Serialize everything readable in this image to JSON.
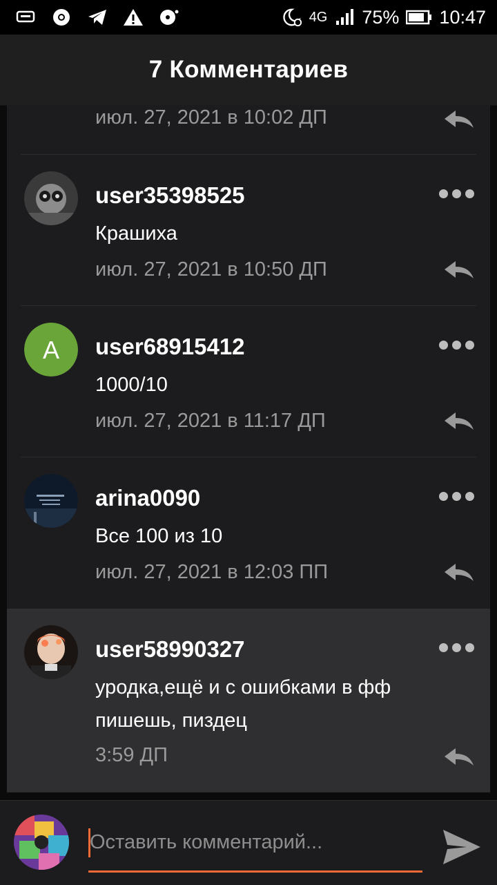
{
  "statusbar": {
    "network": "4G",
    "battery": "75%",
    "time": "10:47",
    "icons": [
      "chat-icon",
      "chrome-icon",
      "telegram-icon",
      "warning-icon",
      "cd-icon",
      "moon-alarm-icon",
      "signal-icon",
      "battery-icon"
    ]
  },
  "header": {
    "title": "7 Комментариев"
  },
  "partial": {
    "date": "июл. 27, 2021 в 10:02 ДП"
  },
  "comments": [
    {
      "username": "user35398525",
      "text": "Крашиха",
      "date": "июл. 27, 2021 в 10:50 ДП",
      "avatar": "photo"
    },
    {
      "username": "user68915412",
      "text": "1000/10",
      "date": "июл. 27, 2021 в 11:17 ДП",
      "avatar_letter": "A",
      "avatar_color": "#6aa53a"
    },
    {
      "username": "arina0090",
      "text": "Все 100 из 10",
      "date": "июл. 27, 2021 в 12:03 ПП",
      "avatar": "photo"
    },
    {
      "username": "user58990327",
      "text": "уродка,ещё и с ошибками в фф пишешь, пиздец",
      "date": "3:59 ДП",
      "avatar": "photo"
    }
  ],
  "composer": {
    "placeholder": "Оставить комментарий..."
  },
  "colors": {
    "accent": "#f06a35",
    "background": "#1c1c1e",
    "highlight": "#2f2f31"
  }
}
